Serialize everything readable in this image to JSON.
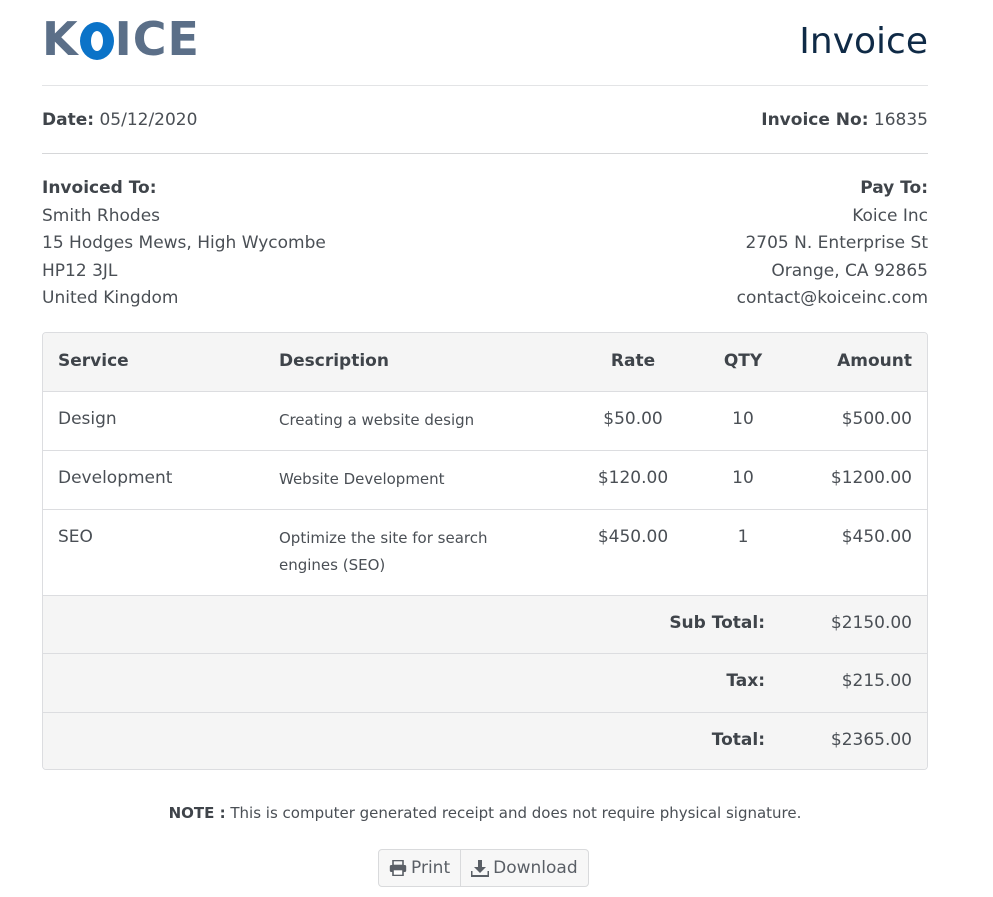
{
  "brand": {
    "logo_pre": "K",
    "logo_post": "ICE",
    "logo_color": "#5b6f88",
    "logo_accent": "#0b73c8"
  },
  "title": "Invoice",
  "meta": {
    "date_label": "Date:",
    "date_value": "05/12/2020",
    "invoice_no_label": "Invoice No:",
    "invoice_no_value": "16835"
  },
  "invoiced_to": {
    "label": "Invoiced To:",
    "lines": [
      "Smith Rhodes",
      "15 Hodges Mews, High Wycombe",
      "HP12 3JL",
      "United Kingdom"
    ]
  },
  "pay_to": {
    "label": "Pay To:",
    "lines": [
      "Koice Inc",
      "2705 N. Enterprise St",
      "Orange, CA 92865",
      "contact@koiceinc.com"
    ]
  },
  "table": {
    "headers": {
      "service": "Service",
      "description": "Description",
      "rate": "Rate",
      "qty": "QTY",
      "amount": "Amount"
    },
    "rows": [
      {
        "service": "Design",
        "description": "Creating a website design",
        "rate": "$50.00",
        "qty": "10",
        "amount": "$500.00"
      },
      {
        "service": "Development",
        "description": "Website Development",
        "rate": "$120.00",
        "qty": "10",
        "amount": "$1200.00"
      },
      {
        "service": "SEO",
        "description": "Optimize the site for search engines (SEO)",
        "rate": "$450.00",
        "qty": "1",
        "amount": "$450.00"
      }
    ],
    "totals": [
      {
        "label": "Sub Total:",
        "value": "$2150.00"
      },
      {
        "label": "Tax:",
        "value": "$215.00"
      },
      {
        "label": "Total:",
        "value": "$2365.00"
      }
    ]
  },
  "note": {
    "label": "NOTE :",
    "text": "This is computer generated receipt and does not require physical signature."
  },
  "actions": {
    "print_label": "Print",
    "download_label": "Download",
    "print_icon": "printer-icon",
    "download_icon": "download-icon"
  }
}
